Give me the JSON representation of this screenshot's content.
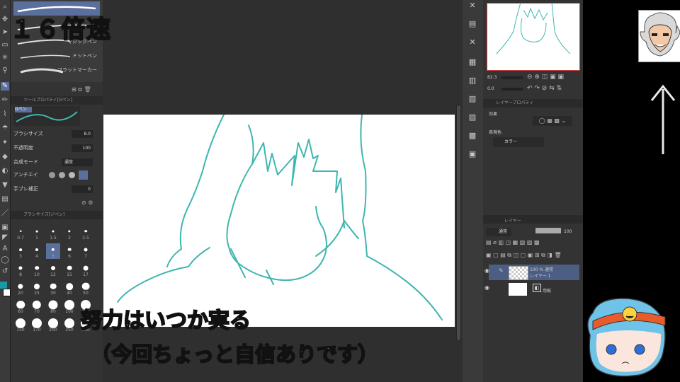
{
  "overlay": {
    "speed_label": "１６倍速",
    "subtitle_line1": "努力はいつか実る",
    "subtitle_line2": "（今回ちょっと自信ありです）"
  },
  "brush_panel": {
    "brushes": [
      "マジックペン",
      "ドットペン",
      "フラットマーカー"
    ]
  },
  "tool_property": {
    "header": "ツールプロパティ[Gペン]",
    "tab": "Gペン",
    "brush_size_label": "ブラシサイズ",
    "brush_size_value": "8.0",
    "opacity_label": "不透明度",
    "opacity_value": "100",
    "blend_label": "合成モード",
    "blend_value": "通常",
    "antialias_label": "アンチエイ",
    "stabilize_label": "手ブレ補正",
    "stabilize_value": "0"
  },
  "brush_size_palette": {
    "header": "ブラシサイズ[ジペン]",
    "sizes": [
      "0.7",
      "1",
      "1.5",
      "2",
      "2.5",
      "3",
      "4",
      "5",
      "6",
      "7",
      "8",
      "10",
      "12",
      "15",
      "17",
      "20",
      "25",
      "30",
      "40",
      "50",
      "60",
      "70",
      "80",
      "100",
      "120",
      "150",
      "170",
      "200",
      "250",
      "300"
    ],
    "selected": "5"
  },
  "navigator": {
    "zoom": "82.3",
    "angle": "0.0"
  },
  "layer_property": {
    "header": "レイヤープロパティ",
    "effect_label": "効果",
    "color_label": "表現色",
    "color_value": "カラー"
  },
  "layer_panel": {
    "header": "レイヤー",
    "blend_mode": "通常",
    "opacity": "100",
    "layers": [
      {
        "name_line1": "100 % 通常",
        "name_line2": "レイヤー 1"
      },
      {
        "name_line1": "用紙",
        "name_line2": ""
      }
    ]
  },
  "colors": {
    "ui_bg": "#333333",
    "accent": "#5b6f9c",
    "sketch_stroke": "#3fb6b0",
    "caption_fill": "#fff6a8"
  }
}
